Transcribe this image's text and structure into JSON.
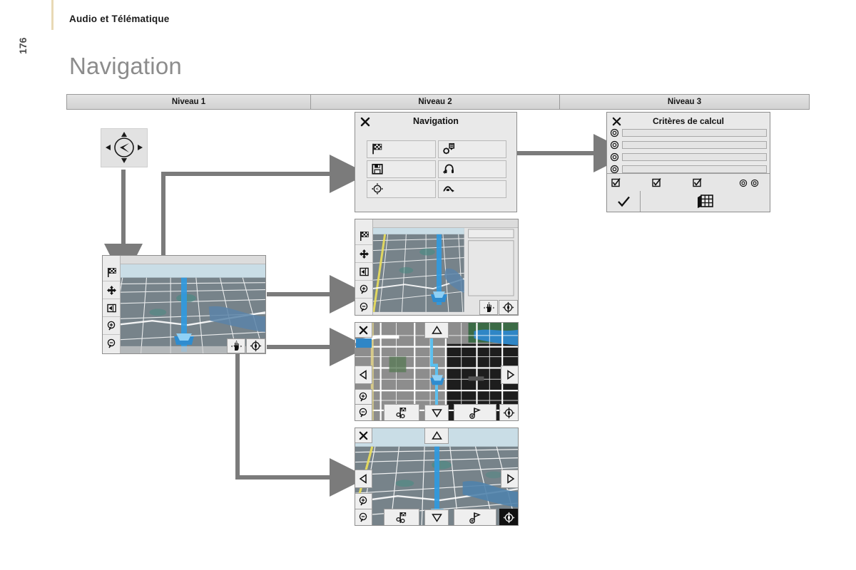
{
  "header": {
    "breadcrumb": "Audio et Télématique",
    "page_number": "176",
    "title": "Navigation"
  },
  "levels": [
    {
      "label": "Niveau 1"
    },
    {
      "label": "Niveau 2"
    },
    {
      "label": "Niveau 3"
    }
  ],
  "niveau1": {
    "joystick": {
      "icon": "joystick-directional-icon"
    },
    "map_screen": {
      "name": "map-3d-screen",
      "sidebar": [
        {
          "icon": "checkered-flag-icon"
        },
        {
          "icon": "four-way-move-icon"
        },
        {
          "icon": "exit-arrow-icon"
        },
        {
          "icon": "zoom-in-icon"
        },
        {
          "icon": "zoom-out-icon"
        }
      ],
      "controls": [
        {
          "icon": "hand-pan-icon"
        },
        {
          "icon": "compass-icon"
        }
      ]
    }
  },
  "niveau2": {
    "navigation_menu": {
      "title": "Navigation",
      "close_icon": "close-icon",
      "buttons": [
        {
          "icon": "checkered-flag-icon"
        },
        {
          "icon": "route-settings-icon"
        },
        {
          "icon": "floppy-save-icon"
        },
        {
          "icon": "headset-traffic-icon"
        },
        {
          "icon": "compass-joystick-icon"
        },
        {
          "icon": "u-turn-route-icon"
        }
      ]
    },
    "map_split_screen": {
      "name": "map-split-screen",
      "sidebar": [
        {
          "icon": "checkered-flag-icon"
        },
        {
          "icon": "four-way-move-icon"
        },
        {
          "icon": "exit-arrow-icon"
        },
        {
          "icon": "zoom-in-icon"
        },
        {
          "icon": "zoom-out-icon"
        }
      ],
      "controls": [
        {
          "icon": "hand-pan-icon"
        },
        {
          "icon": "compass-icon"
        }
      ]
    },
    "map_2d_screen": {
      "name": "map-2d-pan-screen",
      "close_icon": "close-icon",
      "pan": [
        {
          "icon": "arrow-up-icon"
        },
        {
          "icon": "arrow-left-icon"
        },
        {
          "icon": "arrow-right-icon"
        },
        {
          "icon": "arrow-down-icon"
        }
      ],
      "sidebar": [
        {
          "icon": "zoom-in-icon"
        },
        {
          "icon": "zoom-out-icon"
        }
      ],
      "bottom": [
        {
          "icon": "poi-flag-icon"
        },
        {
          "icon": "add-waypoint-flag-icon"
        },
        {
          "icon": "compass-icon"
        }
      ]
    },
    "map_3d_screen": {
      "name": "map-3d-pan-screen",
      "close_icon": "close-icon",
      "pan": [
        {
          "icon": "arrow-up-icon"
        },
        {
          "icon": "arrow-left-icon"
        },
        {
          "icon": "arrow-right-icon"
        },
        {
          "icon": "arrow-down-icon"
        }
      ],
      "sidebar": [
        {
          "icon": "zoom-in-icon"
        },
        {
          "icon": "zoom-out-icon"
        }
      ],
      "bottom": [
        {
          "icon": "poi-flag-icon"
        },
        {
          "icon": "add-waypoint-flag-icon"
        },
        {
          "icon": "compass-icon"
        }
      ]
    }
  },
  "niveau3": {
    "criteria_panel": {
      "title": "Critères de calcul",
      "close_icon": "close-icon",
      "options": [
        {
          "radio": "radio-unselected",
          "value": ""
        },
        {
          "radio": "radio-unselected",
          "value": ""
        },
        {
          "radio": "radio-unselected",
          "value": ""
        },
        {
          "radio": "radio-unselected",
          "value": ""
        }
      ],
      "toolbar": [
        {
          "icon": "checkbox-checked-icon"
        },
        {
          "icon": "checkbox-checked-icon"
        },
        {
          "icon": "checkbox-checked-icon"
        },
        {
          "icon": "radio-unselected"
        },
        {
          "icon": "radio-unselected"
        }
      ],
      "confirm_icon": "checkmark-icon",
      "grid_icon": "map-grid-icon"
    }
  },
  "colors": {
    "accent": "#e8d9b5",
    "connector": "#7b7b7b",
    "title_gray": "#8c8c8c",
    "panel_bg": "#e9e9e9",
    "header_row": "#dcdcdc"
  }
}
